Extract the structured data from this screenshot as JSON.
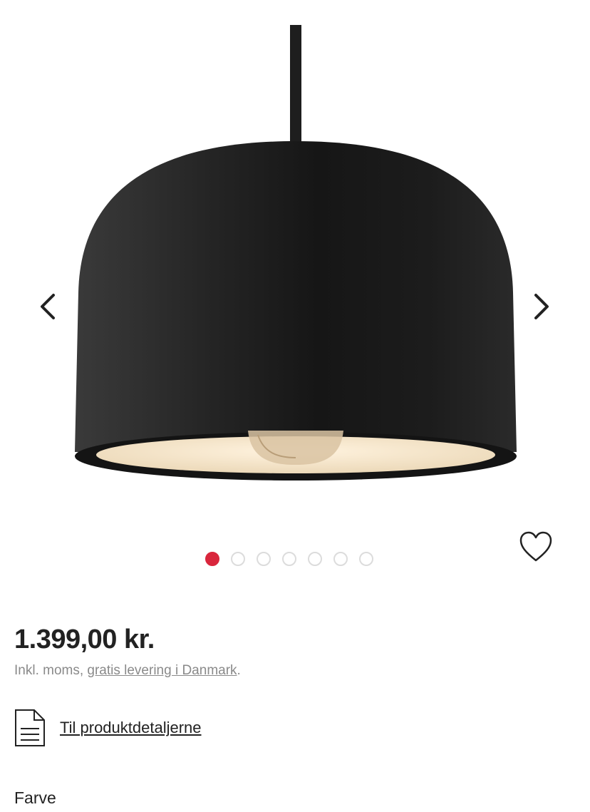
{
  "gallery": {
    "product_image_alt": "pendant-lamp-black",
    "prev_icon": "chevron-left-icon",
    "next_icon": "chevron-right-icon",
    "dots_total": 7,
    "active_dot": 1,
    "active_color": "#d9263c"
  },
  "wishlist": {
    "icon": "heart-outline-icon"
  },
  "price": {
    "amount": "1.399,00 kr.",
    "note_prefix": "Inkl. moms, ",
    "note_link": "gratis levering i Danmark",
    "note_suffix": "."
  },
  "details": {
    "icon": "document-icon",
    "label": "Til produktdetaljerne"
  },
  "options": {
    "color_label": "Farve"
  }
}
